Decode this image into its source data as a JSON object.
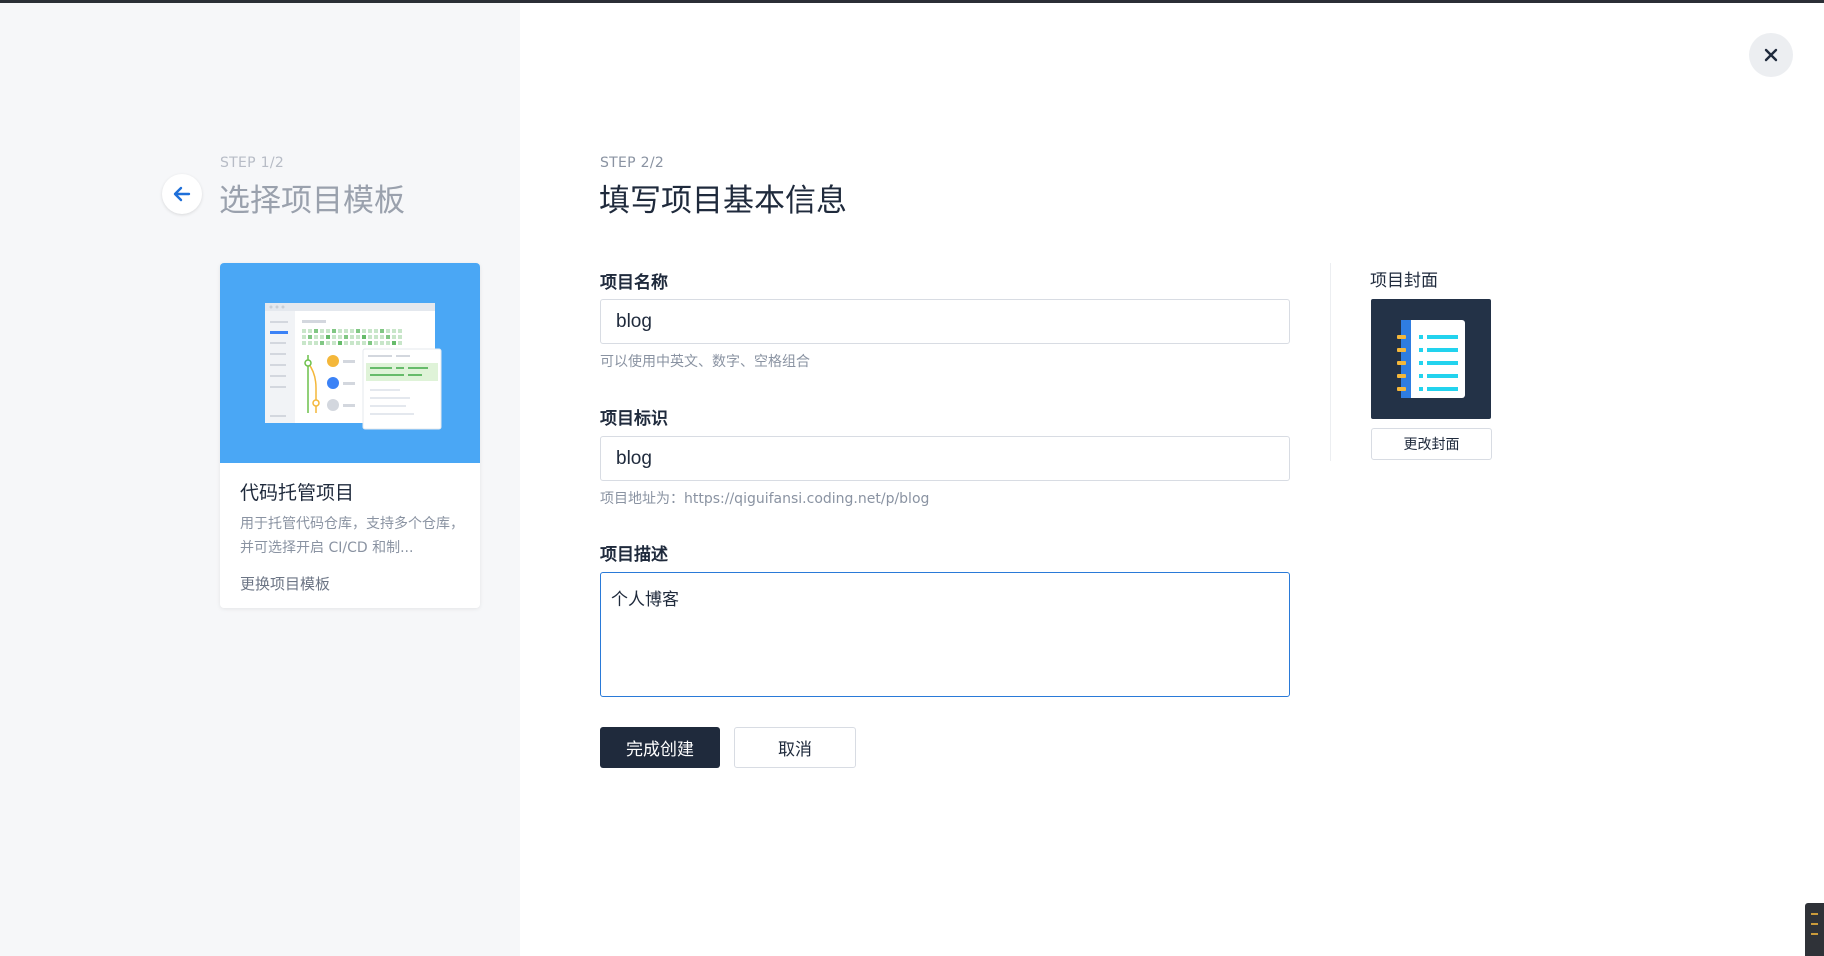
{
  "left": {
    "step": "STEP 1/2",
    "title": "选择项目模板",
    "template": {
      "name": "代码托管项目",
      "description": "用于托管代码仓库，支持多个仓库，并可选择开启 CI/CD 和制...",
      "change_label": "更换项目模板"
    }
  },
  "main": {
    "step": "STEP 2/2",
    "title": "填写项目基本信息",
    "name_field": {
      "label": "项目名称",
      "value": "blog",
      "hint": "可以使用中英文、数字、空格组合"
    },
    "id_field": {
      "label": "项目标识",
      "value": "blog",
      "hint": "项目地址为：https://qiguifansi.coding.net/p/blog"
    },
    "desc_field": {
      "label": "项目描述",
      "value": "个人博客"
    },
    "submit_label": "完成创建",
    "cancel_label": "取消"
  },
  "cover": {
    "label": "项目封面",
    "change_label": "更改封面"
  },
  "colors": {
    "primary": "#1f2a3c",
    "accent_blue": "#4aa7f5",
    "focus_border": "#2a7ad8",
    "cover_bg": "#233247",
    "cover_lines": "#22d3ee",
    "cover_bookmarks": "#f4b73a"
  },
  "icons": {
    "back": "arrow-left-icon",
    "close": "close-icon"
  }
}
